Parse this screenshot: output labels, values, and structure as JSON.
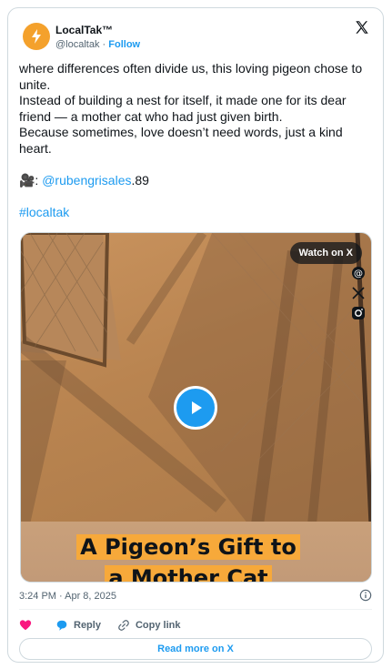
{
  "author": {
    "name": "LocalTak™",
    "handle": "@localtak",
    "separator": "·",
    "follow_label": "Follow"
  },
  "post": {
    "lines": [
      "where differences often divide us, this loving pigeon chose to unite.",
      "Instead of building a nest for itself, it made one for its dear friend — a mother cat who had just given birth.",
      "Because sometimes, love doesn’t need words, just a kind heart."
    ],
    "credit_prefix": "🎥: ",
    "credit_link": "@rubengrisales",
    "credit_suffix": ".89",
    "hashtag": "#localtak"
  },
  "media": {
    "watch_label": "Watch on X",
    "caption_line1": "A Pigeon’s Gift to",
    "caption_line2": "a Mother Cat",
    "icons": [
      "threads-icon",
      "x-icon",
      "instagram-icon"
    ]
  },
  "meta": {
    "timestamp": "3:24 PM · Apr 8, 2025"
  },
  "actions": {
    "reply_label": "Reply",
    "copy_label": "Copy link"
  },
  "read_more_label": "Read more on X",
  "colors": {
    "accent": "#1d9bf0",
    "like": "#f91880",
    "caption_highlight": "#f7a93a",
    "avatar": "#f4a12c"
  }
}
